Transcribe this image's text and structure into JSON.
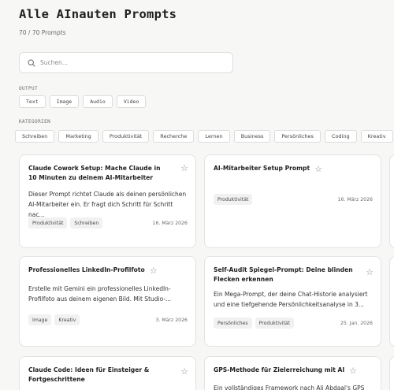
{
  "header": {
    "title": "Alle AInauten Prompts",
    "count": "70 / 70 Prompts"
  },
  "search": {
    "placeholder": "Suchen..."
  },
  "output": {
    "label": "OUTPUT",
    "items": [
      "Text",
      "Image",
      "Audio",
      "Video"
    ]
  },
  "kategorien": {
    "label": "KATEGORIEN",
    "items": [
      "Schreiben",
      "Marketing",
      "Produktivität",
      "Recherche",
      "Lernen",
      "Business",
      "Persönliches",
      "Coding",
      "Kreativ"
    ]
  },
  "star_glyph": "☆",
  "cards": [
    {
      "title": "Claude Cowork Setup: Mache Claude in 10 Minuten zu deinem AI-Mitarbeiter",
      "description": "Dieser Prompt richtet Claude als deinen persönlichen\nAI-Mitarbeiter ein. Er fragt dich Schritt für Schritt nac...",
      "tags": [
        "Produktivität",
        "Schreiben"
      ],
      "date": "16. März 2026"
    },
    {
      "title": "AI-Mitarbeiter Setup Prompt",
      "description": "",
      "tags": [
        "Produktivität"
      ],
      "date": "16. März 2026"
    },
    {
      "title": "Professionelles LinkedIn-Profilfoto",
      "description": "Erstelle mit Gemini ein professionelles LinkedIn-\nProfilfoto aus deinem eigenen Bild. Mit Studio-...",
      "tags": [
        "Image",
        "Kreativ"
      ],
      "date": "3. März 2026"
    },
    {
      "title": "Self-Audit Spiegel-Prompt: Deine blinden Flecken erkennen",
      "description": "Ein Mega-Prompt, der deine Chat-Historie analysiert\nund eine tiefgehende Persönlichkeitsanalyse in 3...",
      "tags": [
        "Persönliches",
        "Produktivität"
      ],
      "date": "25. Jan. 2026"
    },
    {
      "title": "Claude Code: Ideen für Einsteiger & Fortgeschrittene",
      "description": "",
      "tags": [],
      "date": ""
    },
    {
      "title": "GPS-Methode für Zielerreichung mit AI",
      "description": "Ein vollständiges Framework nach Ali Abdaal's GPS",
      "tags": [],
      "date": ""
    }
  ]
}
